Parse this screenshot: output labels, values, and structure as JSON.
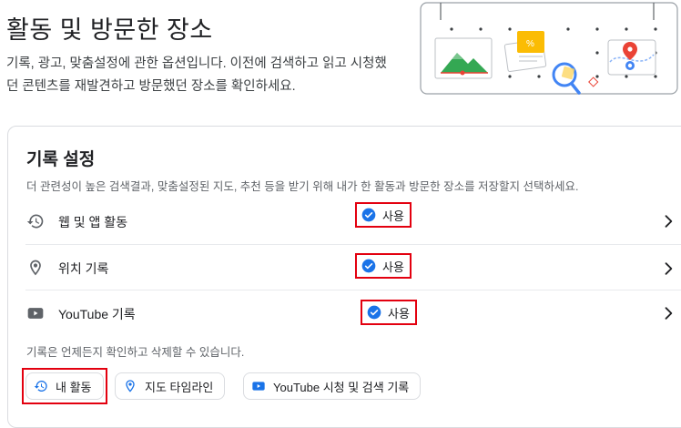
{
  "header": {
    "title": "활동 및 방문한 장소",
    "description": "기록, 광고, 맞춤설정에 관한 옵션입니다. 이전에 검색하고 읽고 시청했던 콘텐츠를 재발견하고 방문했던 장소를 확인하세요."
  },
  "history": {
    "title": "기록 설정",
    "description": "더 관련성이 높은 검색결과, 맞춤설정된 지도, 추천 등을 받기 위해 내가 한 활동과 방문한 장소를 저장할지 선택하세요.",
    "rows": [
      {
        "label": "웹 및 앱 활동",
        "status": "사용",
        "icon": "history-icon"
      },
      {
        "label": "위치 기록",
        "status": "사용",
        "icon": "location-pin-icon"
      },
      {
        "label": "YouTube 기록",
        "status": "사용",
        "icon": "youtube-icon"
      }
    ],
    "footnote": "기록은 언제든지 확인하고 삭제할 수 있습니다."
  },
  "chips": [
    {
      "label": "내 활동",
      "icon": "history-icon"
    },
    {
      "label": "지도 타임라인",
      "icon": "location-pin-icon"
    },
    {
      "label": "YouTube 시청 및 검색 기록",
      "icon": "youtube-icon"
    }
  ],
  "colors": {
    "accent_blue": "#1a73e8",
    "highlight_red": "#e3000f",
    "icon_gray": "#5f6368",
    "divider": "#e8eaed"
  }
}
